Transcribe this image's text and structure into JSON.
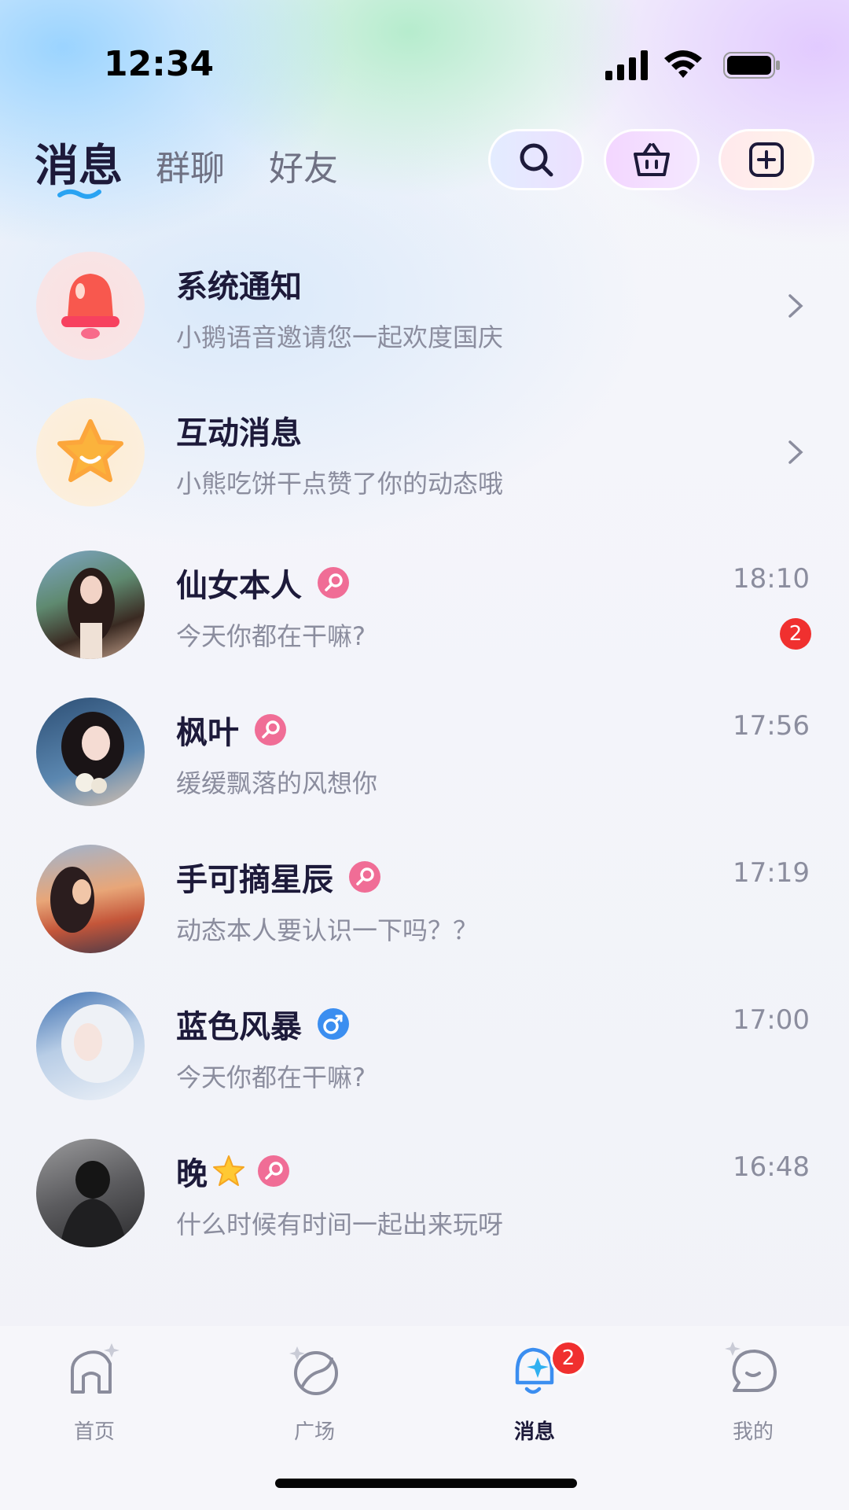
{
  "status_bar": {
    "time": "12:34"
  },
  "header": {
    "tabs": [
      {
        "label": "消息",
        "active": true
      },
      {
        "label": "群聊",
        "active": false
      },
      {
        "label": "好友",
        "active": false
      }
    ],
    "buttons": {
      "search_icon": "search-icon",
      "shop_icon": "basket-icon",
      "add_icon": "plus-square-icon"
    }
  },
  "system_items": [
    {
      "title": "系统通知",
      "subtitle": "小鹅语音邀请您一起欢度国庆",
      "icon": "bell-icon"
    },
    {
      "title": "互动消息",
      "subtitle": "小熊吃饼干点赞了你的动态哦",
      "icon": "star-icon"
    }
  ],
  "chats": [
    {
      "name": "仙女本人",
      "gender": "female",
      "message": "今天你都在干嘛?",
      "time": "18:10",
      "unread": "2"
    },
    {
      "name": "枫叶",
      "gender": "female",
      "message": "缓缓飘落的风想你",
      "time": "17:56"
    },
    {
      "name": "手可摘星辰",
      "gender": "female",
      "message": "动态本人要认识一下吗？？",
      "time": "17:19"
    },
    {
      "name": "蓝色风暴",
      "gender": "male",
      "message": "今天你都在干嘛?",
      "time": "17:00"
    },
    {
      "name": "晚",
      "gender": "female",
      "message": "什么时候有时间一起出来玩呀",
      "time": "16:48"
    }
  ],
  "bottom_nav": [
    {
      "label": "首页",
      "icon": "home-icon",
      "active": false
    },
    {
      "label": "广场",
      "icon": "planet-icon",
      "active": false
    },
    {
      "label": "消息",
      "icon": "bell-icon",
      "active": true,
      "badge": "2"
    },
    {
      "label": "我的",
      "icon": "profile-icon",
      "active": false
    }
  ],
  "colors": {
    "accent": "#1d1a3a",
    "badge": "#f0302f",
    "female": "#f06d96",
    "male": "#3b8ef0",
    "tab_underline": "#2aa3f2"
  }
}
